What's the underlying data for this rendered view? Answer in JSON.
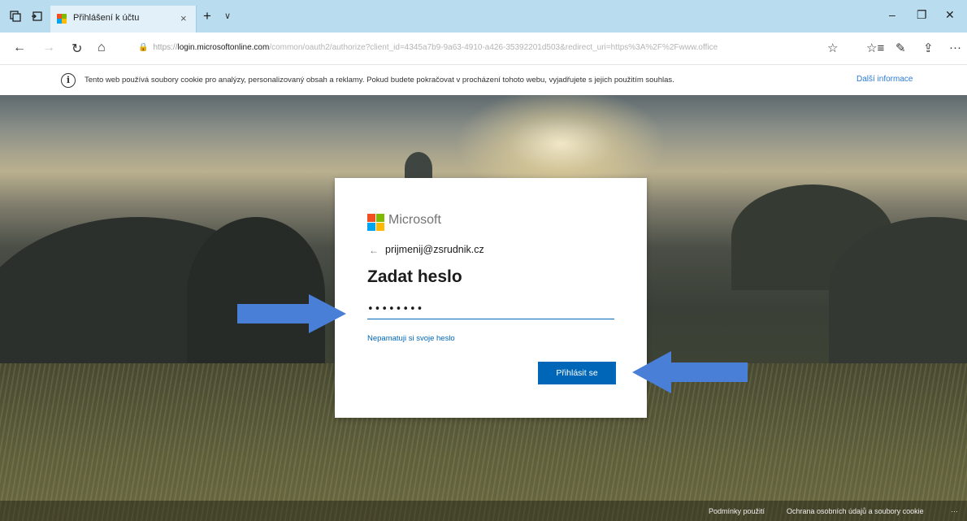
{
  "tab": {
    "title": "Přihlášení k účtu",
    "close": "×",
    "new": "+",
    "dropdown": "∨"
  },
  "window_controls": {
    "minimize": "–",
    "restore": "❐",
    "close": "✕"
  },
  "nav": {
    "back": "←",
    "forward": "→",
    "refresh": "↻",
    "home": "⌂"
  },
  "address": {
    "prefix": "https://",
    "host": "login.microsoftonline.com",
    "path": "/common/oauth2/authorize?client_id=4345a7b9-9a63-4910-a426-35392201d503&redirect_uri=https%3A%2F%2Fwww.office"
  },
  "toolbar": {
    "favorite": "☆",
    "favorites": "☆≡",
    "notes": "✎",
    "share": "⇪",
    "more": "···"
  },
  "cookie_bar": {
    "icon": "i",
    "text": "Tento web používá soubory cookie pro analýzy, personalizovaný obsah a reklamy. Pokud budete pokračovat v procházení tohoto webu, vyjadřujete s jejich použitím souhlas.",
    "link": "Další informace"
  },
  "login": {
    "brand": "Microsoft",
    "back_arrow": "←",
    "identity": "prijmenij@zsrudnik.cz",
    "title": "Zadat heslo",
    "password_value": "••••••••",
    "forgot_link": "Nepamatuji si svoje heslo",
    "signin_button": "Přihlásit se"
  },
  "footer": {
    "terms": "Podmínky použití",
    "privacy": "Ochrana osobních údajů a soubory cookie",
    "more": "···"
  },
  "colors": {
    "accent": "#0067b8",
    "annotation_arrow": "#4a7fd8",
    "tabbar": "#b9dcef"
  }
}
